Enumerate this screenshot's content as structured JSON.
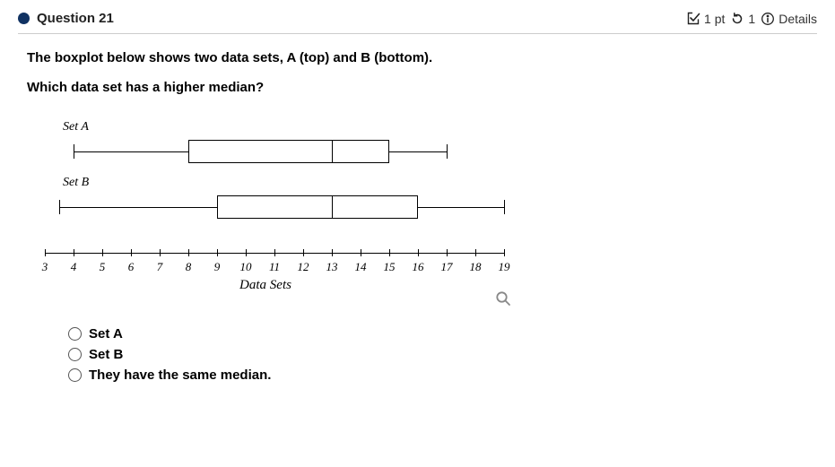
{
  "header": {
    "question_label": "Question 21",
    "points": "1 pt",
    "attempts": "1",
    "details_label": "Details"
  },
  "prompt": {
    "line1": "The boxplot below shows two data sets, A (top) and B (bottom).",
    "line2": "Which data set has a higher median?"
  },
  "chart_labels": {
    "setA": "Set A",
    "setB": "Set B",
    "axis_title": "Data Sets"
  },
  "chart_data": {
    "type": "boxplot",
    "xlabel": "Data Sets",
    "xlim": [
      3,
      19
    ],
    "xticks": [
      3,
      4,
      5,
      6,
      7,
      8,
      9,
      10,
      11,
      12,
      13,
      14,
      15,
      16,
      17,
      18,
      19
    ],
    "series": [
      {
        "name": "Set A",
        "min": 4,
        "q1": 8,
        "median": 13,
        "q3": 15,
        "max": 17
      },
      {
        "name": "Set B",
        "min": 3.5,
        "q1": 9,
        "median": 13,
        "q3": 16,
        "max": 19
      }
    ]
  },
  "options": [
    {
      "label": "Set A"
    },
    {
      "label": "Set B"
    },
    {
      "label": "They have the same median."
    }
  ]
}
